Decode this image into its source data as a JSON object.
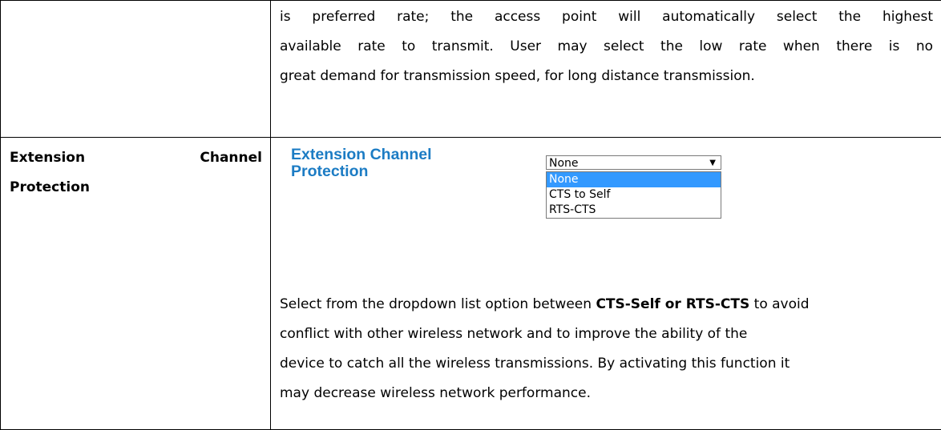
{
  "row1": {
    "lines": [
      "is preferred rate; the access point will automatically select the highest",
      "available rate to transmit. User may select the low rate when there is no",
      "great demand for transmission speed, for long distance transmission."
    ]
  },
  "row2": {
    "label_line1_left": "Extension",
    "label_line1_right": "Channel",
    "label_line2": "Protection",
    "screenshot": {
      "label_line1": "Extension Channel",
      "label_line2": "Protection",
      "selected_value": "None",
      "arrow_icon": "▼",
      "options": [
        "None",
        "CTS to Self",
        "RTS-CTS"
      ],
      "highlight_color": "#3399ff",
      "label_color": "#1c7cc4"
    },
    "desc_prefix": "Select from the dropdown list option between ",
    "desc_bold": "CTS-Self or RTS-CTS",
    "desc_suffix": " to avoid",
    "desc_lines": [
      "conflict with other wireless network and to improve the ability of the",
      "device to catch all the wireless transmissions. By activating this function it",
      "may decrease wireless network performance."
    ]
  }
}
